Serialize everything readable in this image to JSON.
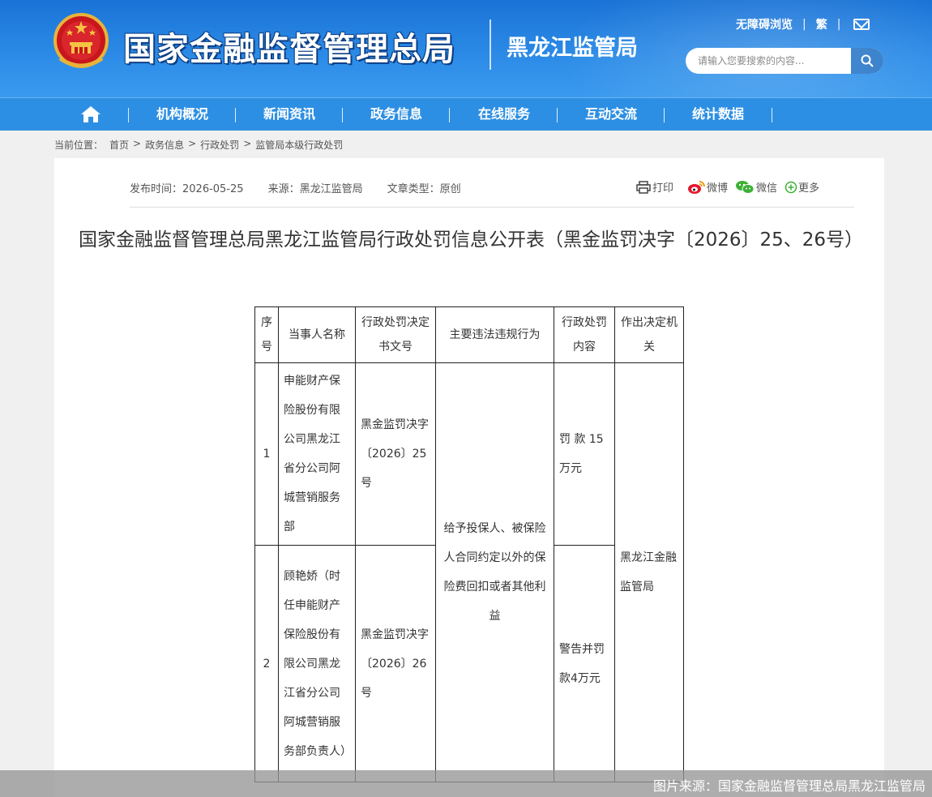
{
  "header": {
    "site_title": "国家金融监督管理总局",
    "bureau_name": "黑龙江监管局",
    "top_links": {
      "accessible": "无障碍浏览",
      "traditional": "繁"
    },
    "search": {
      "placeholder": "请输入您要搜索的内容..."
    },
    "accent": "#2d8fe3"
  },
  "nav": {
    "items": [
      "机构概况",
      "新闻资讯",
      "政务信息",
      "在线服务",
      "互动交流",
      "统计数据"
    ]
  },
  "breadcrumb": {
    "prefix": "当前位置：",
    "items": [
      "首页",
      "政务信息",
      "行政处罚",
      "监管局本级行政处罚"
    ],
    "separator": ">"
  },
  "article": {
    "publish_time": "发布时间：2026-05-25",
    "source": "来源：黑龙江监管局",
    "doc_type": "文章类型：原创",
    "share": {
      "print": "打印",
      "weibo": "微博",
      "wechat": "微信",
      "more": "更多"
    },
    "title": "国家金融监督管理总局黑龙江监管局行政处罚信息公开表（黑金监罚决字〔2026〕25、26号）"
  },
  "table": {
    "headers": [
      "序号",
      "当事人名称",
      "行政处罚决定书文号",
      "主要违法违规行为",
      "行政处罚内容",
      "作出决定机关"
    ],
    "rows": [
      {
        "index": "1",
        "party": "申能财产保险股份有限公司黑龙江省分公司阿城营销服务部",
        "doc_no": "黑金监罚决字〔2026〕25号",
        "penalty": "罚 款 15 万元"
      },
      {
        "index": "2",
        "party": "顾艳娇（时任申能财产保险股份有限公司黑龙江省分公司阿城营销服务部负责人）",
        "doc_no": "黑金监罚决字〔2026〕26号",
        "penalty": "警告并罚款4万元"
      }
    ],
    "violation": "给予投保人、被保险人合同约定以外的保险费回扣或者其他利益",
    "authority": "黑龙江金融监管局"
  },
  "footer": {
    "image_source": "图片来源：国家金融监督管理总局黑龙江监管局"
  }
}
